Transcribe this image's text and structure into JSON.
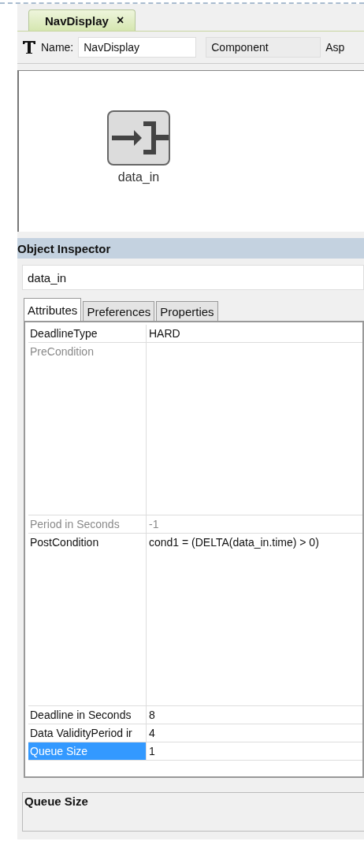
{
  "editor_tab": {
    "title": "NavDisplay",
    "close": "×",
    "selected": true
  },
  "toolbar": {
    "name_label": "Name:",
    "name_value": "NavDisplay",
    "type_value": "Component",
    "cut_label": "Asp"
  },
  "canvas": {
    "nodes": [
      {
        "label": "data_in"
      }
    ]
  },
  "inspector": {
    "title": "Object Inspector",
    "object_name": "data_in",
    "tabs": [
      {
        "label": "Attributes",
        "selected": true
      },
      {
        "label": "Preferences",
        "selected": false
      },
      {
        "label": "Properties",
        "selected": false
      }
    ],
    "rows": [
      {
        "kind": "single",
        "name": "DeadlineType",
        "value": "HARD",
        "disabled": false,
        "selected": false
      },
      {
        "kind": "multiline",
        "name": "PreCondition",
        "disabled": true,
        "selected": false
      },
      {
        "kind": "single",
        "name": "Period in Seconds",
        "value": "-1",
        "disabled": true,
        "selected": false
      },
      {
        "kind": "multiline",
        "name": "PostCondition",
        "value": "cond1 = (DELTA(data_in.time) > 0)",
        "disabled": false,
        "selected": false
      },
      {
        "kind": "single",
        "name": "Deadline in Seconds",
        "value": "8",
        "disabled": false,
        "selected": false
      },
      {
        "kind": "single",
        "name": "Data ValidityPeriod ir",
        "value": "4",
        "disabled": false,
        "selected": false
      },
      {
        "kind": "single",
        "name": "Queue Size",
        "value": "1",
        "disabled": false,
        "selected": true
      }
    ],
    "description": {
      "title": "Queue Size"
    }
  }
}
